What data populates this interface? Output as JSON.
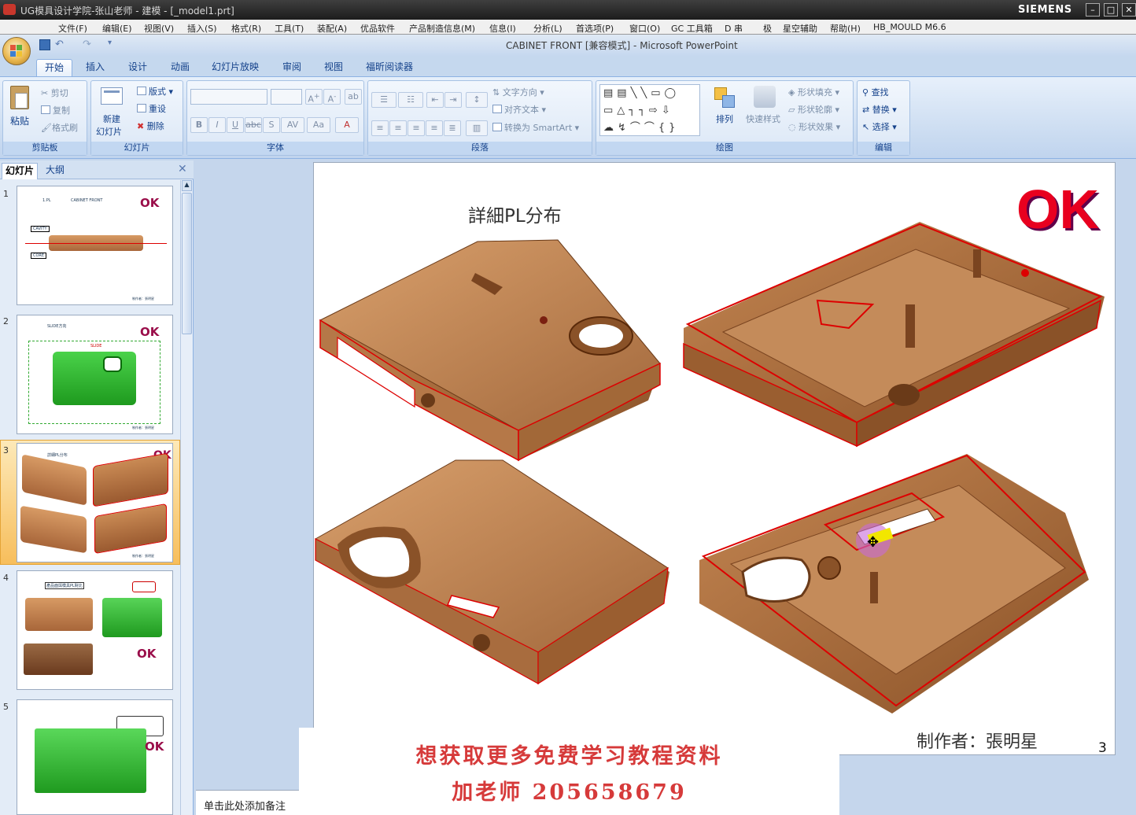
{
  "ug": {
    "title": "UG模具设计学院-张山老师 - 建模 - [_model1.prt]",
    "brand": "SIEMENS",
    "menu": [
      "文件(F)",
      "编辑(E)",
      "视图(V)",
      "插入(S)",
      "格式(R)",
      "工具(T)",
      "装配(A)",
      "优品软件",
      "产品制造信息(M)",
      "信息(I)",
      "分析(L)",
      "首选项(P)",
      "窗口(O)",
      "GC 工具箱",
      "D 串",
      "极",
      "星空辅助",
      "帮助(H)",
      "HB_MOULD M6.6"
    ]
  },
  "ppt": {
    "title": "CABINET FRONT [兼容模式] - Microsoft PowerPoint",
    "tabs": [
      "开始",
      "插入",
      "设计",
      "动画",
      "幻灯片放映",
      "审阅",
      "视图",
      "福昕阅读器"
    ],
    "groups": {
      "clipboard": {
        "label": "剪贴板",
        "paste": "粘贴",
        "cut": "剪切",
        "copy": "复制",
        "format_painter": "格式刷"
      },
      "slides": {
        "label": "幻灯片",
        "new_slide_1": "新建",
        "new_slide_2": "幻灯片",
        "layout": "版式",
        "reset": "重设",
        "delete": "删除"
      },
      "font": {
        "label": "字体"
      },
      "paragraph": {
        "label": "段落",
        "text_direction": "文字方向",
        "align_text": "对齐文本",
        "smartart": "转换为 SmartArt"
      },
      "drawing": {
        "label": "绘图",
        "arrange": "排列",
        "quick_styles": "快速样式",
        "shape_fill": "形状填充",
        "shape_outline": "形状轮廓",
        "shape_effects": "形状效果"
      },
      "editing": {
        "label": "编辑",
        "find": "查找",
        "replace": "替换",
        "select": "选择"
      }
    },
    "pane_tabs": [
      "幻灯片",
      "大纲"
    ],
    "thumbs": [
      {
        "num": "1",
        "ok": "OK",
        "title": "CABINET FRONT",
        "pl": "1.PL",
        "cavity": "CAVITY",
        "core": "CORE",
        "footer": "制作者：張明星"
      },
      {
        "num": "2",
        "ok": "OK",
        "title": "SLIDE方向",
        "slide": "SLIDE",
        "footer": "制作者：張明星"
      },
      {
        "num": "3",
        "ok": "OK",
        "title": "詳細PL分布",
        "footer": "制作者：張明星"
      },
      {
        "num": "4",
        "ok": "OK",
        "title": "產品面與模具PL對比"
      },
      {
        "num": "5",
        "ok": "OK"
      }
    ],
    "slide": {
      "title": "詳細PL分布",
      "ok": "OK",
      "author": "制作者：張明星",
      "page": "3"
    },
    "notes_placeholder": "单击此处添加备注"
  },
  "overlay": {
    "line1": "想获取更多免费学习教程资料",
    "line2": "加老师 205658679"
  },
  "colors": {
    "ok_red": "#e8001f",
    "part_brown": "#b07a4a",
    "pl_line": "#e80000",
    "overlay_red": "#d63a3a",
    "ribbon_blue": "#c5d8ee"
  }
}
